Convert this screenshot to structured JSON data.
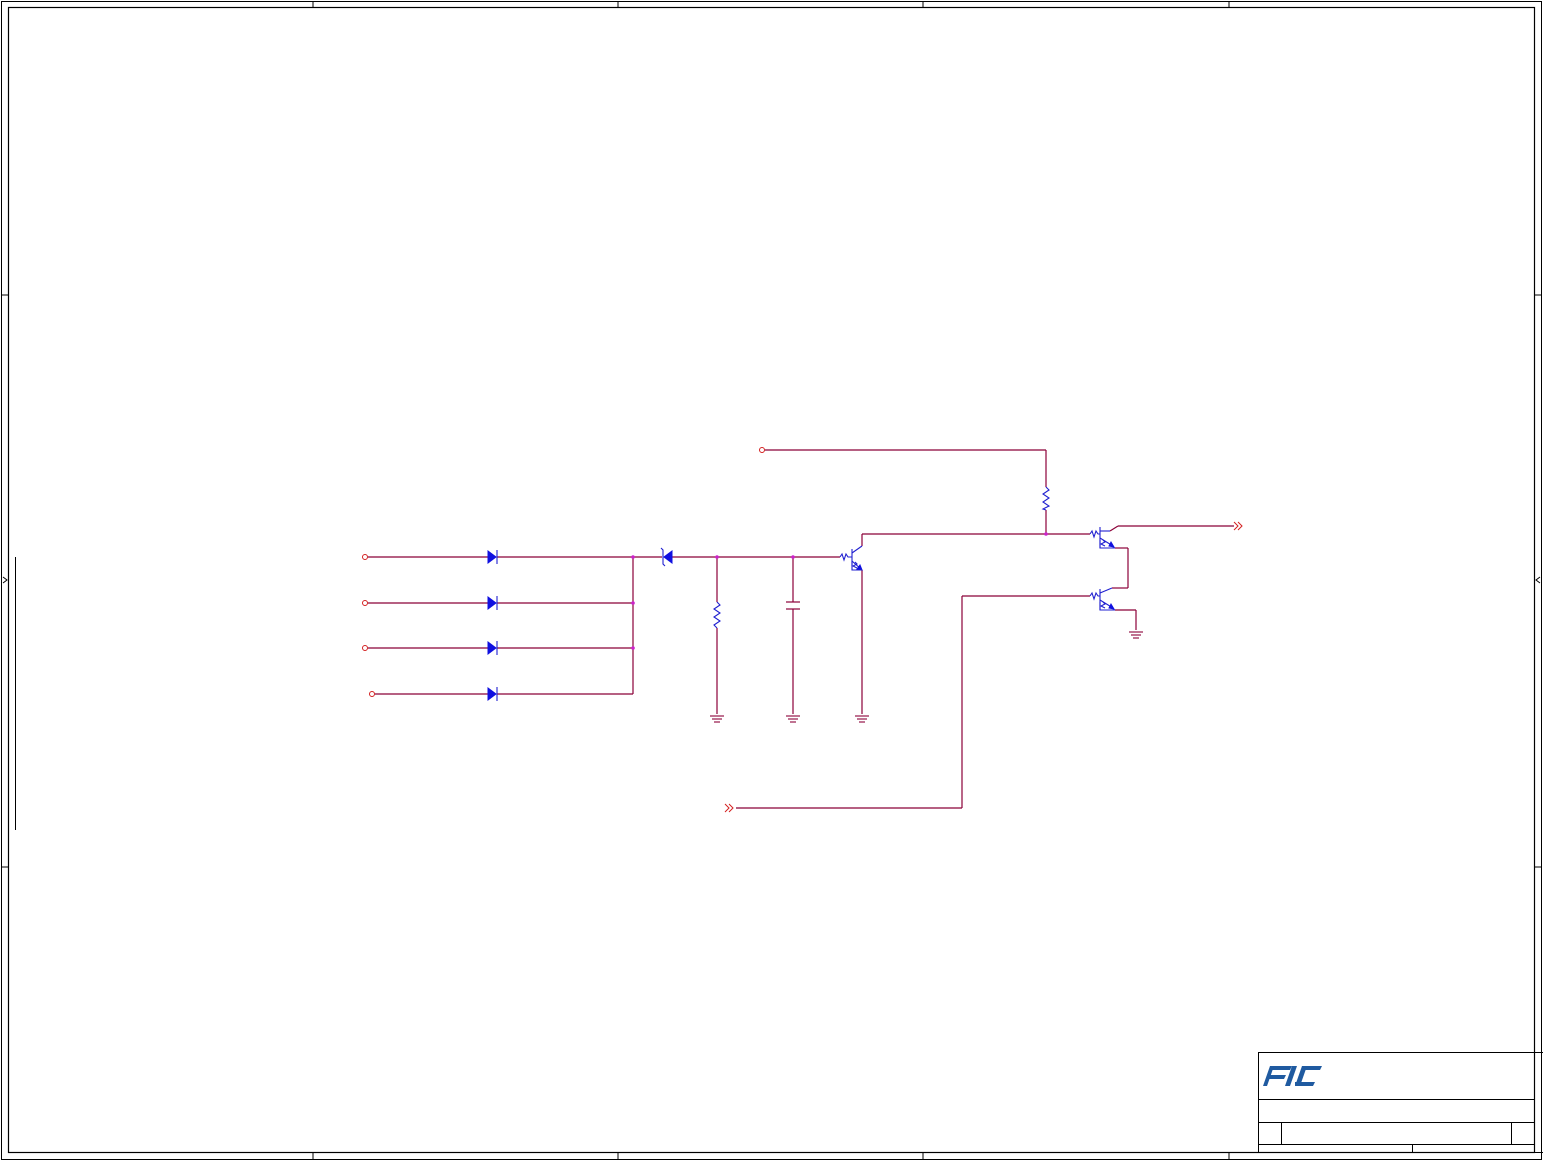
{
  "sheet": {
    "logo_text": "FIC",
    "colors": {
      "wire": "#8b0038",
      "component": "#2020d0",
      "port": "#d42020",
      "junction": "#cc22cc",
      "logo": "#1f5aa0"
    }
  },
  "components": {
    "diodes": [
      "diode-1",
      "diode-2",
      "diode-3",
      "diode-4"
    ],
    "zener": "zener-diode",
    "resistors": [
      "resistor-shunt",
      "resistor-pullup"
    ],
    "capacitor": "capacitor",
    "transistors": [
      "transistor-q1",
      "transistor-q2",
      "transistor-q3"
    ],
    "grounds": [
      "ground-resistor",
      "ground-capacitor",
      "ground-q1",
      "ground-q3"
    ]
  }
}
